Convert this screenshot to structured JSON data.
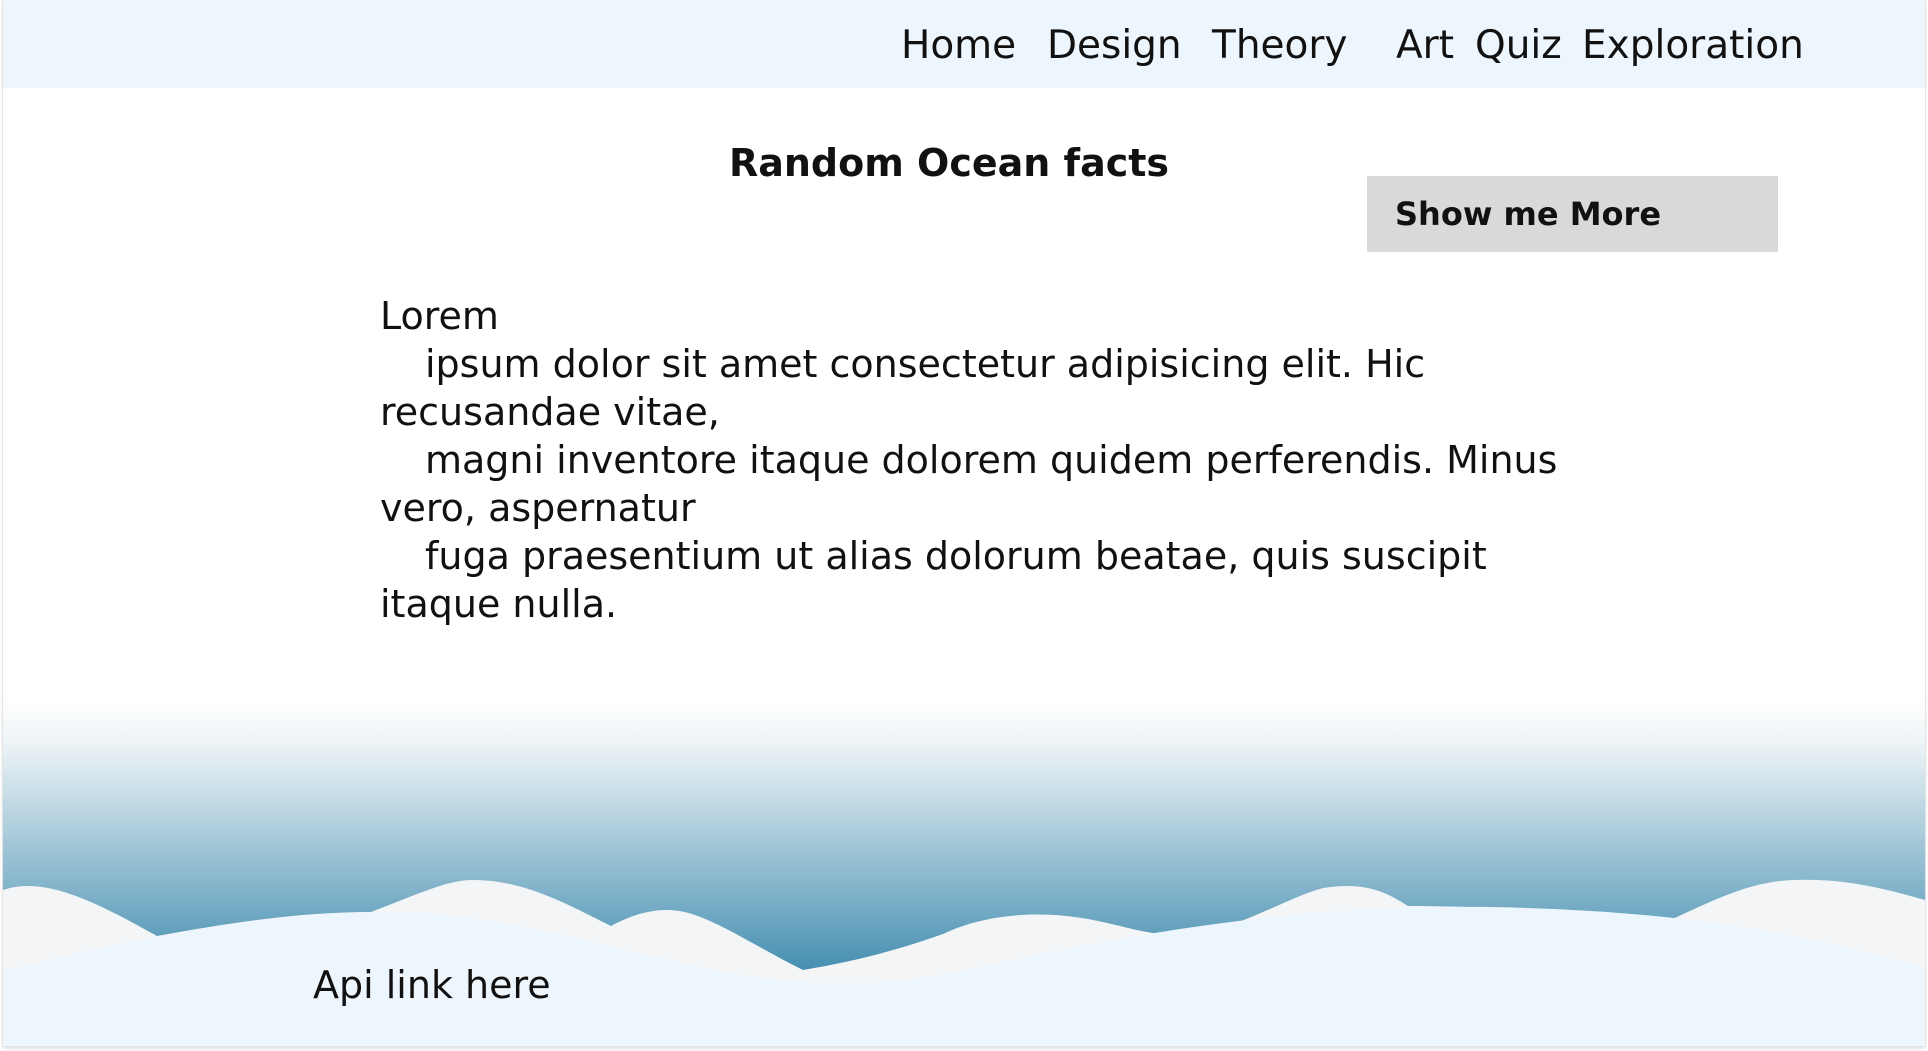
{
  "nav": {
    "items": [
      {
        "label": "Home"
      },
      {
        "label": "Design"
      },
      {
        "label": "Theory"
      },
      {
        "label": "Art"
      },
      {
        "label": "Quiz"
      },
      {
        "label": "Exploration"
      }
    ]
  },
  "main": {
    "title": "Random Ocean facts",
    "more_button_label": "Show me More",
    "fact_lines": [
      "Lorem",
      "ipsum dolor sit amet consectetur adipisicing elit. Hic",
      "recusandae vitae,",
      "magni inventore itaque dolorem quidem perferendis. Minus",
      "vero, aspernatur",
      "fuga praesentium ut alias dolorum beatae, quis suscipit",
      "itaque nulla."
    ]
  },
  "footer": {
    "api_link_label": "Api link here"
  },
  "colors": {
    "nav_background": "#eef6fd",
    "button_background": "#d9d9d9",
    "ocean_top": "#ffffff",
    "ocean_deep": "#3f8bae",
    "wave_light": "#f4f5f6",
    "wave_front": "#eef6fd"
  }
}
